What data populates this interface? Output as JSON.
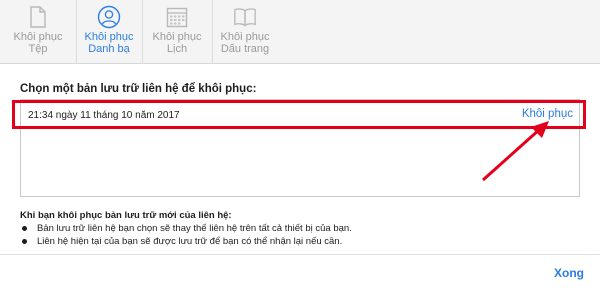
{
  "tabs": [
    {
      "label": "Khôi phục\nTệp",
      "line1": "Khôi phục",
      "line2": "Tệp",
      "icon": "file-icon",
      "active": false
    },
    {
      "label": "Khôi phục\nDanh bạ",
      "line1": "Khôi phục",
      "line2": "Danh bạ",
      "icon": "contacts-icon",
      "active": true
    },
    {
      "label": "Khôi phục\nLịch",
      "line1": "Khôi phục",
      "line2": "Lịch",
      "icon": "calendar-icon",
      "active": false
    },
    {
      "label": "Khôi phục\nDấu trang",
      "line1": "Khôi phục",
      "line2": "Dấu trang",
      "icon": "bookmarks-icon",
      "active": false
    }
  ],
  "main": {
    "title": "Chọn một bản lưu trữ liên hệ để khôi phục:",
    "archive": {
      "date": "21:34 ngày 11 tháng 10 năm 2017",
      "restore_label": "Khôi phục"
    }
  },
  "info": {
    "title": "Khi bạn khôi phục bản lưu trữ mới của liên hệ:",
    "bullets": [
      "Bản lưu trữ liên hệ bạn chọn sẽ thay thế liên hệ trên tất cả thiết bị của bạn.",
      "Liên hệ hiện tại của bạn sẽ được lưu trữ để bạn có thể nhận lại nếu cần."
    ]
  },
  "footer": {
    "done_label": "Xong"
  },
  "colors": {
    "accent": "#2a7de1",
    "highlight": "#e3001b",
    "inactive": "#9a9a9a"
  }
}
